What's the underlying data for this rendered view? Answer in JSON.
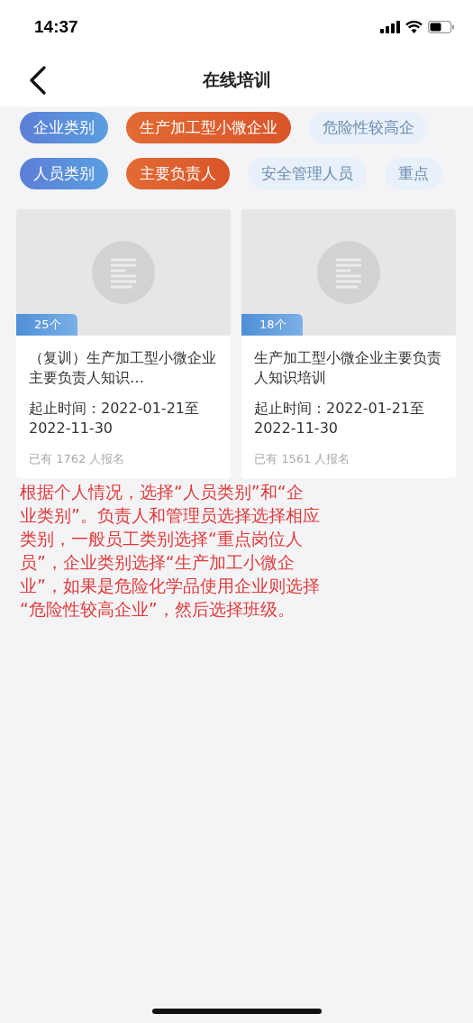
{
  "status_bar": {
    "time": "14:37"
  },
  "header": {
    "title": "在线培训"
  },
  "filter_rows": [
    {
      "chips": [
        {
          "kind": "label",
          "text": "企业类别"
        },
        {
          "kind": "option",
          "text": "生产加工型小微企业",
          "selected": true
        },
        {
          "kind": "option",
          "text": "危险性较高企",
          "selected": false
        }
      ]
    },
    {
      "chips": [
        {
          "kind": "label",
          "text": "人员类别"
        },
        {
          "kind": "option",
          "text": "主要负责人",
          "selected": true
        },
        {
          "kind": "option",
          "text": "安全管理人员",
          "selected": false
        },
        {
          "kind": "option",
          "text": "重点",
          "selected": false
        }
      ]
    }
  ],
  "courses": [
    {
      "count": "25个",
      "title": "（复训）生产加工型小微企业主要负责人知识…",
      "period": "起止时间：2022-01-21至2022-11-30",
      "enrolled": "已有 1762 人报名"
    },
    {
      "count": "18个",
      "title": "生产加工型小微企业主要负责人知识培训",
      "period": "起止时间：2022-01-21至2022-11-30",
      "enrolled": "已有 1561 人报名"
    }
  ],
  "annotation_lines": [
    "根据个人情况，选择“人员类别”和“企",
    "业类别”。负责人和管理员选择选择相应",
    "类别，一般员工类别选择“重点岗位人",
    "员”，企业类别选择“生产加工小微企",
    "业”，如果是危险化学品使用企业则选择",
    "“危险性较高企业”，然后选择班级。"
  ]
}
